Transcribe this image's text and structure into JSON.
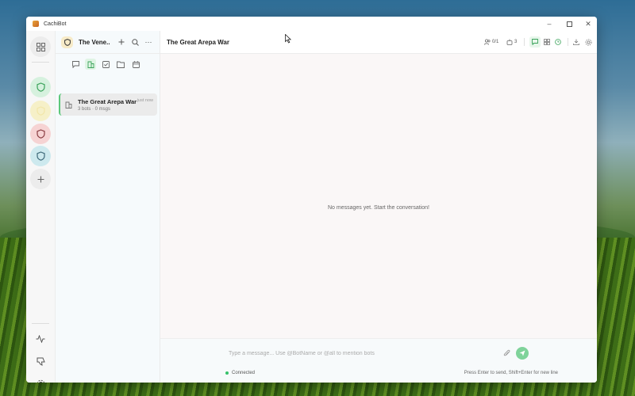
{
  "window": {
    "title": "CachiBot"
  },
  "rail": {
    "items": [
      {
        "name": "dashboard",
        "color": "#efefef"
      },
      {
        "name": "bot-green",
        "color": "#d6f1de",
        "accent": "#3aa35a"
      },
      {
        "name": "bot-yellow",
        "color": "#f6f0c8",
        "accent": "#e8c85a"
      },
      {
        "name": "bot-red",
        "color": "#f6d3d3",
        "accent": "#b8555a"
      },
      {
        "name": "bot-teal",
        "color": "#cde9ee",
        "accent": "#3f7f95"
      }
    ]
  },
  "panel": {
    "title": "The Vene...",
    "conversation": {
      "title": "The Great Arepa War",
      "time": "just now",
      "subtitle": "3 bots · 0 msgs"
    }
  },
  "main": {
    "title": "The Great Arepa War",
    "participants": "0/1",
    "bots": "3",
    "empty_text": "No messages yet. Start the conversation!"
  },
  "composer": {
    "placeholder": "Type a message... Use @BotName or @all to mention bots",
    "status": "Connected",
    "hint": "Press Enter to send, Shift+Enter for new line"
  },
  "colors": {
    "accent": "#5cc77a",
    "send": "#7fd39a"
  }
}
